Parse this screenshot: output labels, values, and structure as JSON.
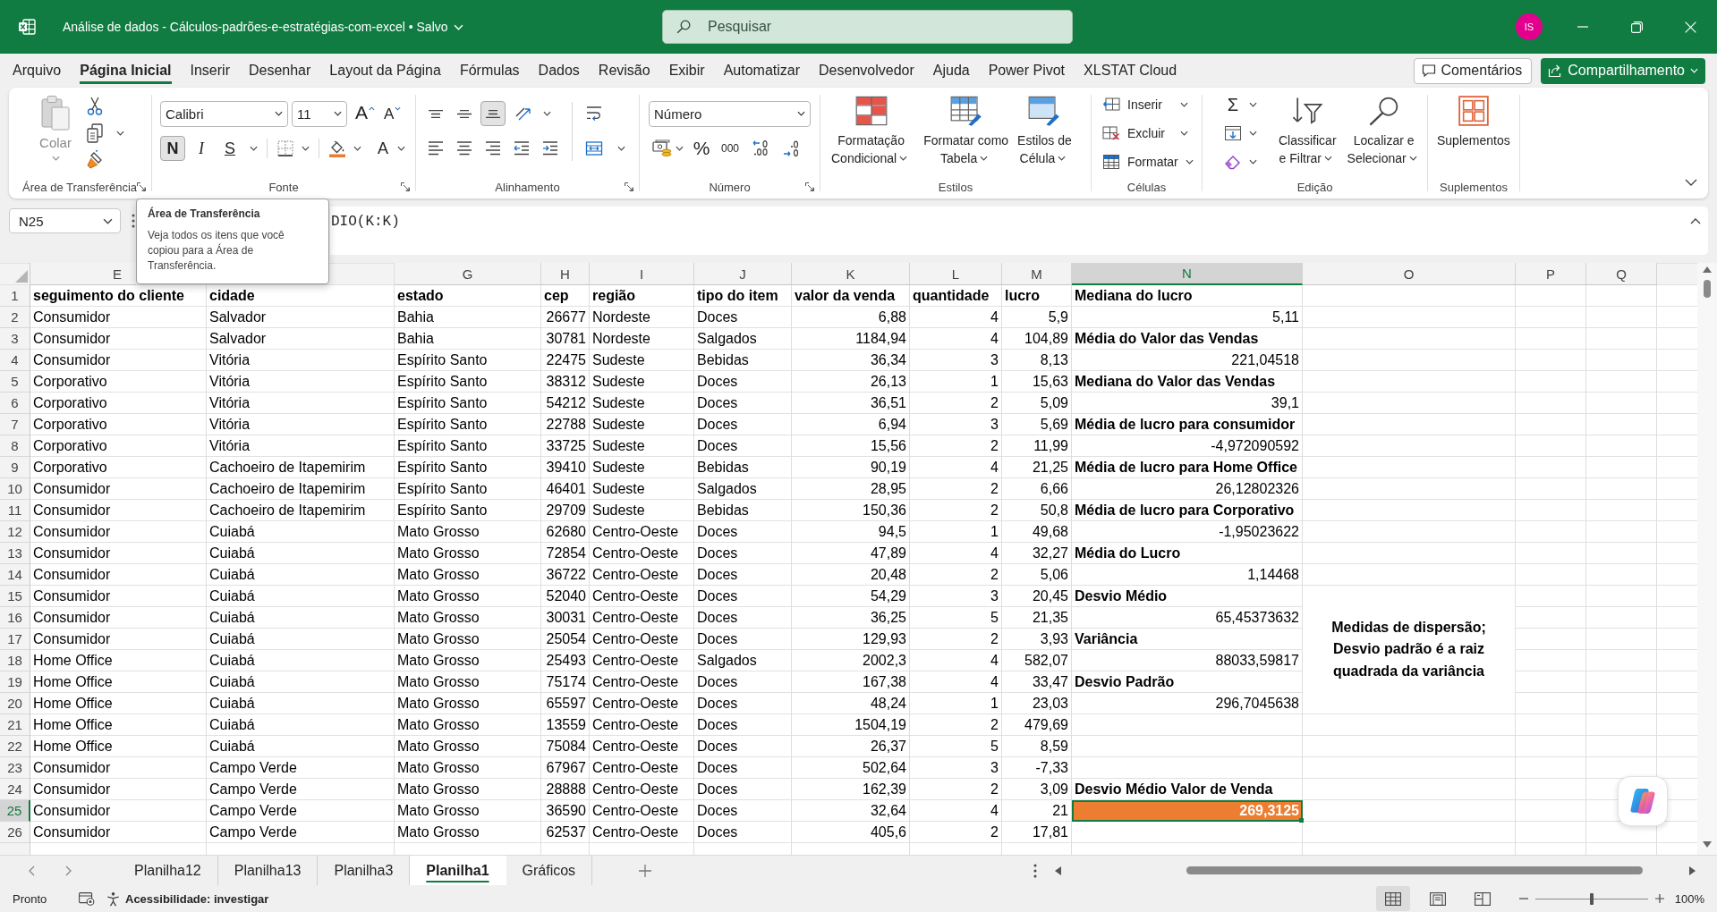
{
  "title_bar": {
    "document_title": "Análise de dados - Cálculos-padrões-e-estratégias-com-excel • Salvo",
    "search": {
      "placeholder": "Pesquisar"
    },
    "avatar": "IS"
  },
  "menu": {
    "tabs": [
      {
        "label": "Arquivo",
        "selected": false
      },
      {
        "label": "Página Inicial",
        "selected": true
      },
      {
        "label": "Inserir",
        "selected": false
      },
      {
        "label": "Desenhar",
        "selected": false
      },
      {
        "label": "Layout da Página",
        "selected": false
      },
      {
        "label": "Fórmulas",
        "selected": false
      },
      {
        "label": "Dados",
        "selected": false
      },
      {
        "label": "Revisão",
        "selected": false
      },
      {
        "label": "Exibir",
        "selected": false
      },
      {
        "label": "Automatizar",
        "selected": false
      },
      {
        "label": "Desenvolvedor",
        "selected": false
      },
      {
        "label": "Ajuda",
        "selected": false
      },
      {
        "label": "Power Pivot",
        "selected": false
      },
      {
        "label": "XLSTAT Cloud",
        "selected": false
      }
    ],
    "comments": "Comentários",
    "share": "Compartilhamento"
  },
  "ribbon": {
    "clipboard": {
      "label": "Área de Transferência",
      "paste": {
        "label": "Colar",
        "disabled": true
      }
    },
    "font": {
      "label": "Fonte",
      "family": "Calibri",
      "size": "11",
      "grow": "A",
      "shrink": "A",
      "toggles": [
        {
          "kind": "bold",
          "label": "N",
          "on": true
        },
        {
          "kind": "italic",
          "label": "I",
          "on": false
        },
        {
          "kind": "underline",
          "label": "S",
          "on": false
        }
      ],
      "ink_button": "A"
    },
    "alignment": {
      "label": "Alinhamento",
      "vertical": [
        {
          "kind": "top",
          "on": false
        },
        {
          "kind": "middle",
          "on": false
        },
        {
          "kind": "bottom",
          "on": true
        }
      ]
    },
    "number": {
      "label": "Número",
      "format": "Número",
      "percent": "%",
      "thousands": "000"
    },
    "styles": {
      "label": "Estilos",
      "buttons": [
        {
          "kind": "conditional",
          "lines": [
            "Formatação",
            "Condicional"
          ]
        },
        {
          "kind": "table",
          "lines": [
            "Formatar como",
            "Tabela"
          ]
        },
        {
          "kind": "cell",
          "lines": [
            "Estilos de",
            "Célula"
          ]
        }
      ]
    },
    "cells": {
      "label": "Células",
      "buttons": [
        {
          "kind": "insert",
          "label": "Inserir"
        },
        {
          "kind": "delete",
          "label": "Excluir"
        },
        {
          "kind": "format",
          "label": "Formatar"
        }
      ]
    },
    "editing": {
      "label": "Edição",
      "sum": "Σ",
      "buttons": [
        {
          "kind": "sort",
          "lines": [
            "Classificar",
            "e Filtrar"
          ]
        },
        {
          "kind": "find",
          "lines": [
            "Localizar e",
            "Selecionar"
          ]
        }
      ]
    },
    "addins": {
      "label": "Suplementos",
      "button": "Suplementos"
    }
  },
  "tooltip": {
    "title": "Área de Transferência",
    "text": "Veja todos os itens que você copiou para a Área de Transferência."
  },
  "formula_bar": {
    "name_box": "N25",
    "formula": "DIO(K:K)"
  },
  "sheet": {
    "columns": [
      {
        "label": "E",
        "kind": "text",
        "selected": false
      },
      {
        "kind": "text"
      },
      {
        "label": "G",
        "kind": "text",
        "selected": false
      },
      {
        "label": "H",
        "kind": "number",
        "selected": false
      },
      {
        "label": "I",
        "kind": "text",
        "selected": false
      },
      {
        "label": "J",
        "kind": "text",
        "selected": false
      },
      {
        "label": "K",
        "kind": "number",
        "selected": false
      },
      {
        "label": "L",
        "kind": "number",
        "selected": false
      },
      {
        "label": "M",
        "kind": "number",
        "selected": false
      },
      {
        "label": "N",
        "selected": true
      },
      {
        "label": "O",
        "selected": false
      },
      {
        "label": "P",
        "selected": false
      },
      {
        "label": "Q",
        "selected": false
      }
    ],
    "rows": [
      {
        "label": "1",
        "selected": false,
        "kind": "header",
        "cells": [
          "seguimento do cliente",
          "cidade",
          "estado",
          "cep",
          "região",
          "tipo do item",
          "valor da venda",
          "quantidade",
          "lucro"
        ],
        "summary": {
          "kind": "label",
          "text": "Mediana do lucro",
          "selected": false,
          "highlight": false
        }
      },
      {
        "label": "2",
        "selected": false,
        "kind": "data",
        "cells": [
          "Consumidor",
          "Salvador",
          "Bahia",
          "26677",
          "Nordeste",
          "Doces",
          "6,88",
          "4",
          "5,9"
        ],
        "summary": {
          "kind": "value",
          "text": "5,11",
          "selected": false,
          "highlight": false
        }
      },
      {
        "label": "3",
        "selected": false,
        "kind": "data",
        "cells": [
          "Consumidor",
          "Salvador",
          "Bahia",
          "30781",
          "Nordeste",
          "Salgados",
          "1184,94",
          "4",
          "104,89"
        ],
        "summary": {
          "kind": "label",
          "text": "Média do Valor das Vendas",
          "selected": false,
          "highlight": false
        }
      },
      {
        "label": "4",
        "selected": false,
        "kind": "data",
        "cells": [
          "Consumidor",
          "Vitória",
          "Espírito Santo",
          "22475",
          "Sudeste",
          "Bebidas",
          "36,34",
          "3",
          "8,13"
        ],
        "summary": {
          "kind": "value",
          "text": "221,04518",
          "selected": false,
          "highlight": false
        }
      },
      {
        "label": "5",
        "selected": false,
        "kind": "data",
        "cells": [
          "Corporativo",
          "Vitória",
          "Espírito Santo",
          "38312",
          "Sudeste",
          "Doces",
          "26,13",
          "1",
          "15,63"
        ],
        "summary": {
          "kind": "label",
          "text": "Mediana do Valor das Vendas",
          "selected": false,
          "highlight": false
        }
      },
      {
        "label": "6",
        "selected": false,
        "kind": "data",
        "cells": [
          "Corporativo",
          "Vitória",
          "Espírito Santo",
          "54212",
          "Sudeste",
          "Doces",
          "36,51",
          "2",
          "5,09"
        ],
        "summary": {
          "kind": "value",
          "text": "39,1",
          "selected": false,
          "highlight": false
        }
      },
      {
        "label": "7",
        "selected": false,
        "kind": "data",
        "cells": [
          "Corporativo",
          "Vitória",
          "Espírito Santo",
          "22788",
          "Sudeste",
          "Doces",
          "6,94",
          "3",
          "5,69"
        ],
        "summary": {
          "kind": "label",
          "text": "Média de lucro para consumidor",
          "selected": false,
          "highlight": false
        }
      },
      {
        "label": "8",
        "selected": false,
        "kind": "data",
        "cells": [
          "Corporativo",
          "Vitória",
          "Espírito Santo",
          "33725",
          "Sudeste",
          "Doces",
          "15,56",
          "2",
          "11,99"
        ],
        "summary": {
          "kind": "value",
          "text": "-4,972090592",
          "selected": false,
          "highlight": false
        }
      },
      {
        "label": "9",
        "selected": false,
        "kind": "data",
        "cells": [
          "Corporativo",
          "Cachoeiro de Itapemirim",
          "Espírito Santo",
          "39410",
          "Sudeste",
          "Bebidas",
          "90,19",
          "4",
          "21,25"
        ],
        "summary": {
          "kind": "label",
          "text": "Média de lucro para Home Office",
          "selected": false,
          "highlight": false
        }
      },
      {
        "label": "10",
        "selected": false,
        "kind": "data",
        "cells": [
          "Consumidor",
          "Cachoeiro de Itapemirim",
          "Espírito Santo",
          "46401",
          "Sudeste",
          "Salgados",
          "28,95",
          "2",
          "6,66"
        ],
        "summary": {
          "kind": "value",
          "text": "26,12802326",
          "selected": false,
          "highlight": false
        }
      },
      {
        "label": "11",
        "selected": false,
        "kind": "data",
        "cells": [
          "Consumidor",
          "Cachoeiro de Itapemirim",
          "Espírito Santo",
          "29709",
          "Sudeste",
          "Bebidas",
          "150,36",
          "2",
          "50,8"
        ],
        "summary": {
          "kind": "label",
          "text": "Média de lucro para Corporativo",
          "selected": false,
          "highlight": false
        }
      },
      {
        "label": "12",
        "selected": false,
        "kind": "data",
        "cells": [
          "Consumidor",
          "Cuiabá",
          "Mato Grosso",
          "62680",
          "Centro-Oeste",
          "Doces",
          "94,5",
          "1",
          "49,68"
        ],
        "summary": {
          "kind": "value",
          "text": "-1,95023622",
          "selected": false,
          "highlight": false
        }
      },
      {
        "label": "13",
        "selected": false,
        "kind": "data",
        "cells": [
          "Consumidor",
          "Cuiabá",
          "Mato Grosso",
          "72854",
          "Centro-Oeste",
          "Doces",
          "47,89",
          "4",
          "32,27"
        ],
        "summary": {
          "kind": "label",
          "text": "Média do Lucro",
          "selected": false,
          "highlight": false
        }
      },
      {
        "label": "14",
        "selected": false,
        "kind": "data",
        "cells": [
          "Consumidor",
          "Cuiabá",
          "Mato Grosso",
          "36722",
          "Centro-Oeste",
          "Doces",
          "20,48",
          "2",
          "5,06"
        ],
        "summary": {
          "kind": "value",
          "text": "1,14468",
          "selected": false,
          "highlight": false
        }
      },
      {
        "label": "15",
        "selected": false,
        "kind": "data",
        "cells": [
          "Consumidor",
          "Cuiabá",
          "Mato Grosso",
          "52040",
          "Centro-Oeste",
          "Doces",
          "54,29",
          "3",
          "20,45"
        ],
        "summary": {
          "kind": "label",
          "text": "Desvio Médio",
          "selected": false,
          "highlight": false
        },
        "note": "Medidas de dispersão; Desvio padrão é a raiz quadrada da variância"
      },
      {
        "label": "16",
        "selected": false,
        "kind": "data",
        "cells": [
          "Consumidor",
          "Cuiabá",
          "Mato Grosso",
          "30031",
          "Centro-Oeste",
          "Doces",
          "36,25",
          "5",
          "21,35"
        ],
        "summary": {
          "kind": "value",
          "text": "65,45373632",
          "selected": false,
          "highlight": false
        }
      },
      {
        "label": "17",
        "selected": false,
        "kind": "data",
        "cells": [
          "Consumidor",
          "Cuiabá",
          "Mato Grosso",
          "25054",
          "Centro-Oeste",
          "Doces",
          "129,93",
          "2",
          "3,93"
        ],
        "summary": {
          "kind": "label",
          "text": "Variância",
          "selected": false,
          "highlight": false
        }
      },
      {
        "label": "18",
        "selected": false,
        "kind": "data",
        "cells": [
          "Home Office",
          "Cuiabá",
          "Mato Grosso",
          "25493",
          "Centro-Oeste",
          "Salgados",
          "2002,3",
          "4",
          "582,07"
        ],
        "summary": {
          "kind": "value",
          "text": "88033,59817",
          "selected": false,
          "highlight": false
        }
      },
      {
        "label": "19",
        "selected": false,
        "kind": "data",
        "cells": [
          "Home Office",
          "Cuiabá",
          "Mato Grosso",
          "75174",
          "Centro-Oeste",
          "Doces",
          "167,38",
          "4",
          "33,47"
        ],
        "summary": {
          "kind": "label",
          "text": "Desvio Padrão",
          "selected": false,
          "highlight": false
        }
      },
      {
        "label": "20",
        "selected": false,
        "kind": "data",
        "cells": [
          "Home Office",
          "Cuiabá",
          "Mato Grosso",
          "65597",
          "Centro-Oeste",
          "Doces",
          "48,24",
          "1",
          "23,03"
        ],
        "summary": {
          "kind": "value",
          "text": "296,7045638",
          "selected": false,
          "highlight": false
        }
      },
      {
        "label": "21",
        "selected": false,
        "kind": "data",
        "cells": [
          "Home Office",
          "Cuiabá",
          "Mato Grosso",
          "13559",
          "Centro-Oeste",
          "Doces",
          "1504,19",
          "2",
          "479,69"
        ]
      },
      {
        "label": "22",
        "selected": false,
        "kind": "data",
        "cells": [
          "Home Office",
          "Cuiabá",
          "Mato Grosso",
          "75084",
          "Centro-Oeste",
          "Doces",
          "26,37",
          "5",
          "8,59"
        ]
      },
      {
        "label": "23",
        "selected": false,
        "kind": "data",
        "cells": [
          "Consumidor",
          "Campo Verde",
          "Mato Grosso",
          "67967",
          "Centro-Oeste",
          "Doces",
          "502,64",
          "3",
          "-7,33"
        ]
      },
      {
        "label": "24",
        "selected": false,
        "kind": "data",
        "cells": [
          "Consumidor",
          "Campo Verde",
          "Mato Grosso",
          "28888",
          "Centro-Oeste",
          "Doces",
          "162,39",
          "2",
          "3,09"
        ],
        "summary": {
          "kind": "label",
          "text": "Desvio Médio Valor de Venda",
          "selected": false,
          "highlight": false
        }
      },
      {
        "label": "25",
        "selected": true,
        "kind": "data",
        "cells": [
          "Consumidor",
          "Campo Verde",
          "Mato Grosso",
          "36590",
          "Centro-Oeste",
          "Doces",
          "32,64",
          "4",
          "21"
        ],
        "summary": {
          "kind": "value",
          "text": "269,3125",
          "selected": true,
          "highlight": true
        }
      },
      {
        "label": "26",
        "selected": false,
        "kind": "data",
        "cells": [
          "Consumidor",
          "Campo Verde",
          "Mato Grosso",
          "62537",
          "Centro-Oeste",
          "Doces",
          "405,6",
          "2",
          "17,81"
        ]
      }
    ]
  },
  "sheet_tabs": [
    {
      "label": "Planilha12",
      "selected": false
    },
    {
      "label": "Planilha13",
      "selected": false
    },
    {
      "label": "Planilha3",
      "selected": false
    },
    {
      "label": "Planilha1",
      "selected": true
    },
    {
      "label": "Gráficos",
      "selected": false
    }
  ],
  "status_bar": {
    "status": "Pronto",
    "accessibility": "Acessibilidade: investigar",
    "views": [
      {
        "kind": "normal",
        "selected": true
      },
      {
        "kind": "page_layout",
        "selected": false
      },
      {
        "kind": "page_break",
        "selected": false
      }
    ],
    "zoom": {
      "level": 0.5,
      "label": "100%"
    }
  }
}
